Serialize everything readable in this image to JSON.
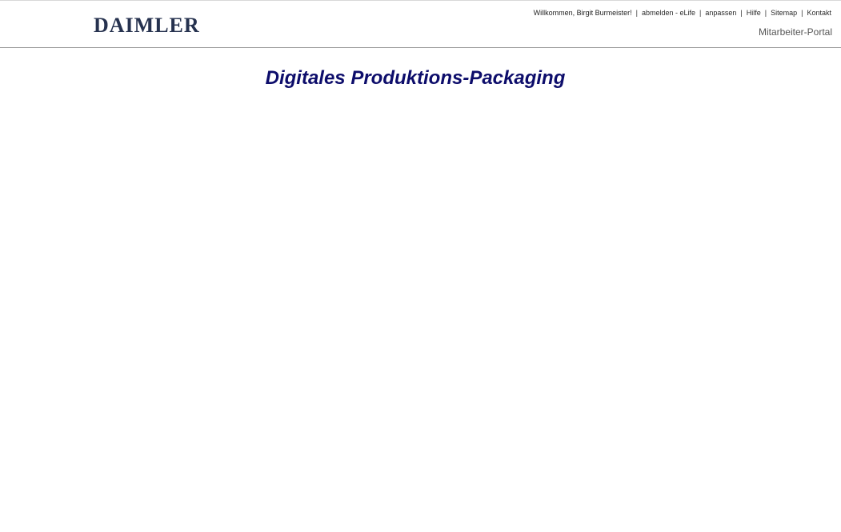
{
  "header": {
    "logo_text": "DAIMLER",
    "welcome_text": "Willkommen, Birgit Burmeister!",
    "links": [
      {
        "label": "abmelden - eLife"
      },
      {
        "label": "anpassen"
      },
      {
        "label": "Hilfe"
      },
      {
        "label": "Sitemap"
      },
      {
        "label": "Kontakt"
      }
    ],
    "portal_name": "Mitarbeiter-Portal"
  },
  "main": {
    "title": "Digitales Produktions-Packaging"
  },
  "colors": {
    "logo": "#26324f",
    "title": "#0d0d6b",
    "header_border": "#9a9a9a"
  }
}
